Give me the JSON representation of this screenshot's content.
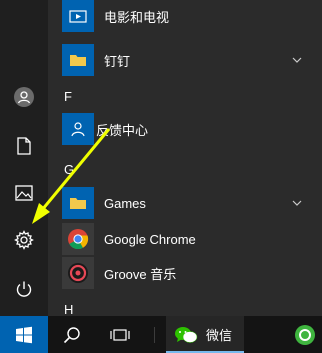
{
  "rail": {
    "items": [
      "user-avatar",
      "document-icon",
      "pictures-icon",
      "settings-gear-icon",
      "power-icon"
    ]
  },
  "apps": {
    "movies": {
      "label": "电影和电视"
    },
    "dingtalk": {
      "label": "钉钉"
    },
    "section_f": "F",
    "feedback": {
      "label": "反馈中心"
    },
    "section_g": "G",
    "games": {
      "label": "Games"
    },
    "chrome": {
      "label": "Google Chrome"
    },
    "groove": {
      "label": "Groove 音乐"
    },
    "section_h": "H"
  },
  "taskbar": {
    "wechat_label": "微信"
  },
  "colors": {
    "accent": "#0063b1",
    "folder": "#f2c94c",
    "arrow": "#f0ff00",
    "rail_bg": "#1f1f1f",
    "list_bg": "#2b2b2b",
    "taskbar_bg": "#141414"
  }
}
